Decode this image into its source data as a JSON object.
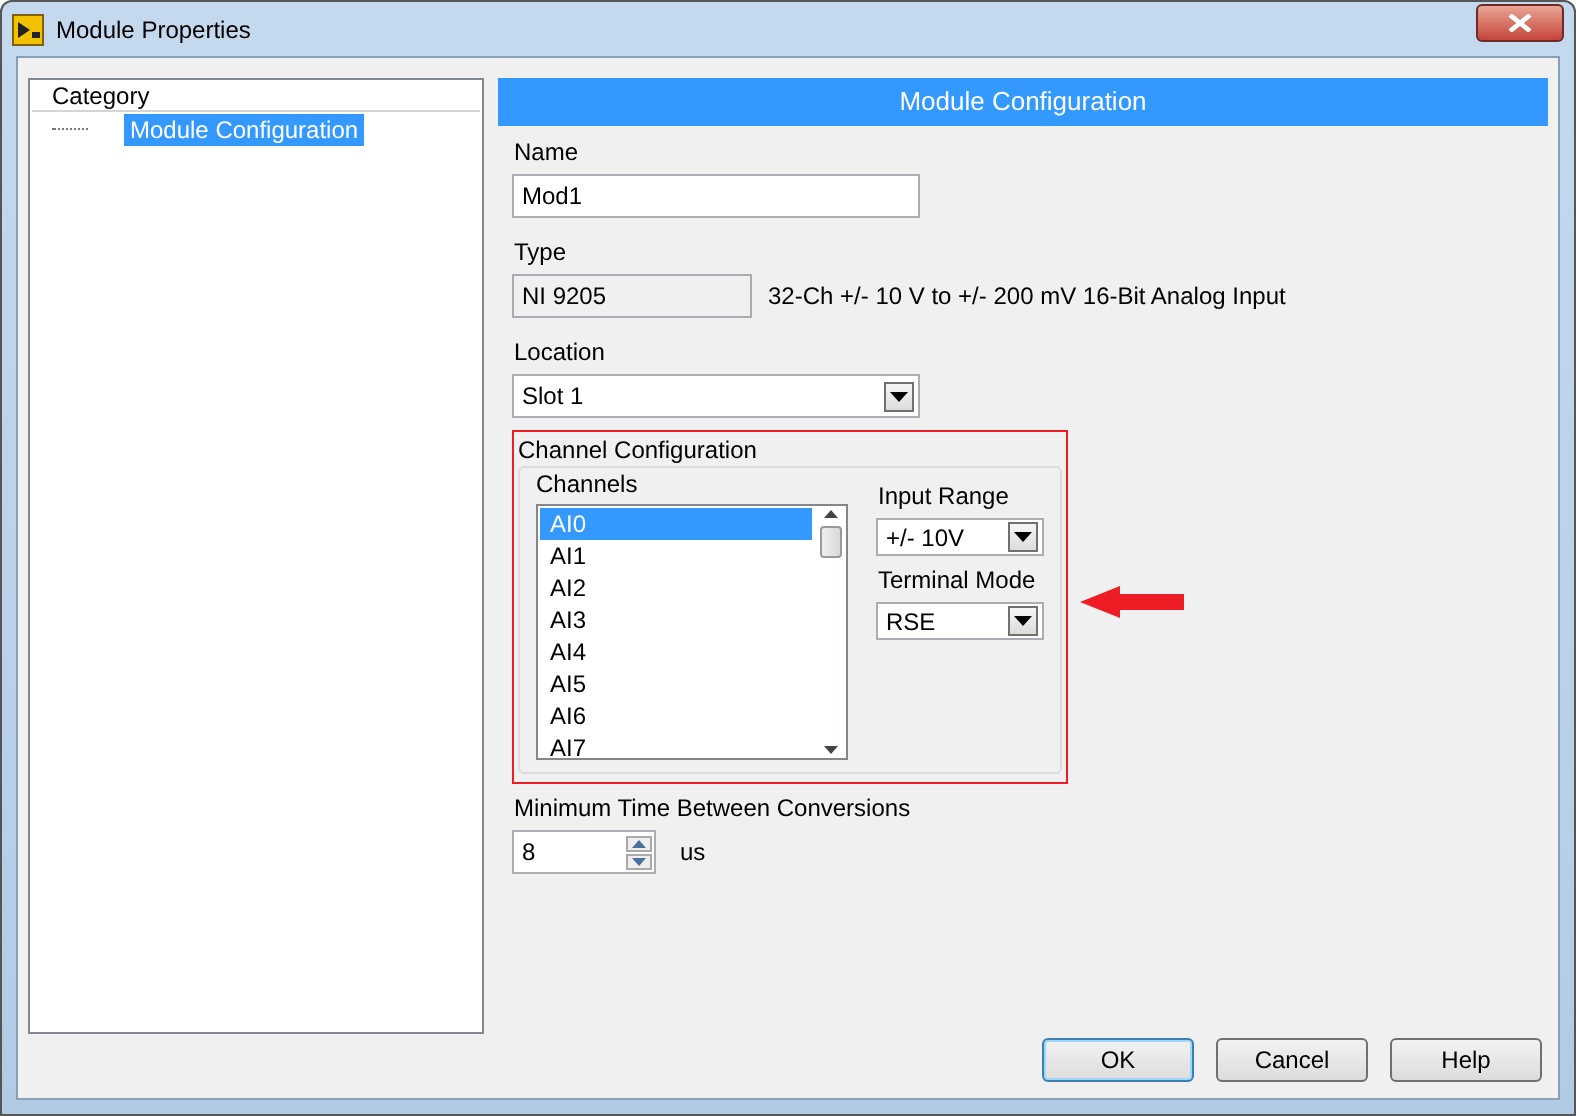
{
  "window": {
    "title": "Module Properties"
  },
  "category": {
    "header": "Category",
    "items": [
      {
        "label": "Module Configuration",
        "selected": true
      }
    ]
  },
  "panel": {
    "title": "Module Configuration"
  },
  "name": {
    "label": "Name",
    "value": "Mod1"
  },
  "type": {
    "label": "Type",
    "value": "NI 9205",
    "description": "32-Ch +/- 10 V to +/- 200 mV 16-Bit Analog Input"
  },
  "location": {
    "label": "Location",
    "value": "Slot 1"
  },
  "channel_configuration": {
    "title": "Channel Configuration",
    "channels_label": "Channels",
    "channels": [
      {
        "label": "AI0",
        "selected": true
      },
      {
        "label": "AI1",
        "selected": false
      },
      {
        "label": "AI2",
        "selected": false
      },
      {
        "label": "AI3",
        "selected": false
      },
      {
        "label": "AI4",
        "selected": false
      },
      {
        "label": "AI5",
        "selected": false
      },
      {
        "label": "AI6",
        "selected": false
      },
      {
        "label": "AI7",
        "selected": false
      }
    ],
    "input_range": {
      "label": "Input Range",
      "value": "+/- 10V"
    },
    "terminal_mode": {
      "label": "Terminal Mode",
      "value": "RSE"
    }
  },
  "min_time": {
    "label": "Minimum Time Between Conversions",
    "value": "8",
    "unit": "us"
  },
  "buttons": [
    {
      "label": "OK",
      "default": true
    },
    {
      "label": "Cancel",
      "default": false
    },
    {
      "label": "Help",
      "default": false
    }
  ]
}
